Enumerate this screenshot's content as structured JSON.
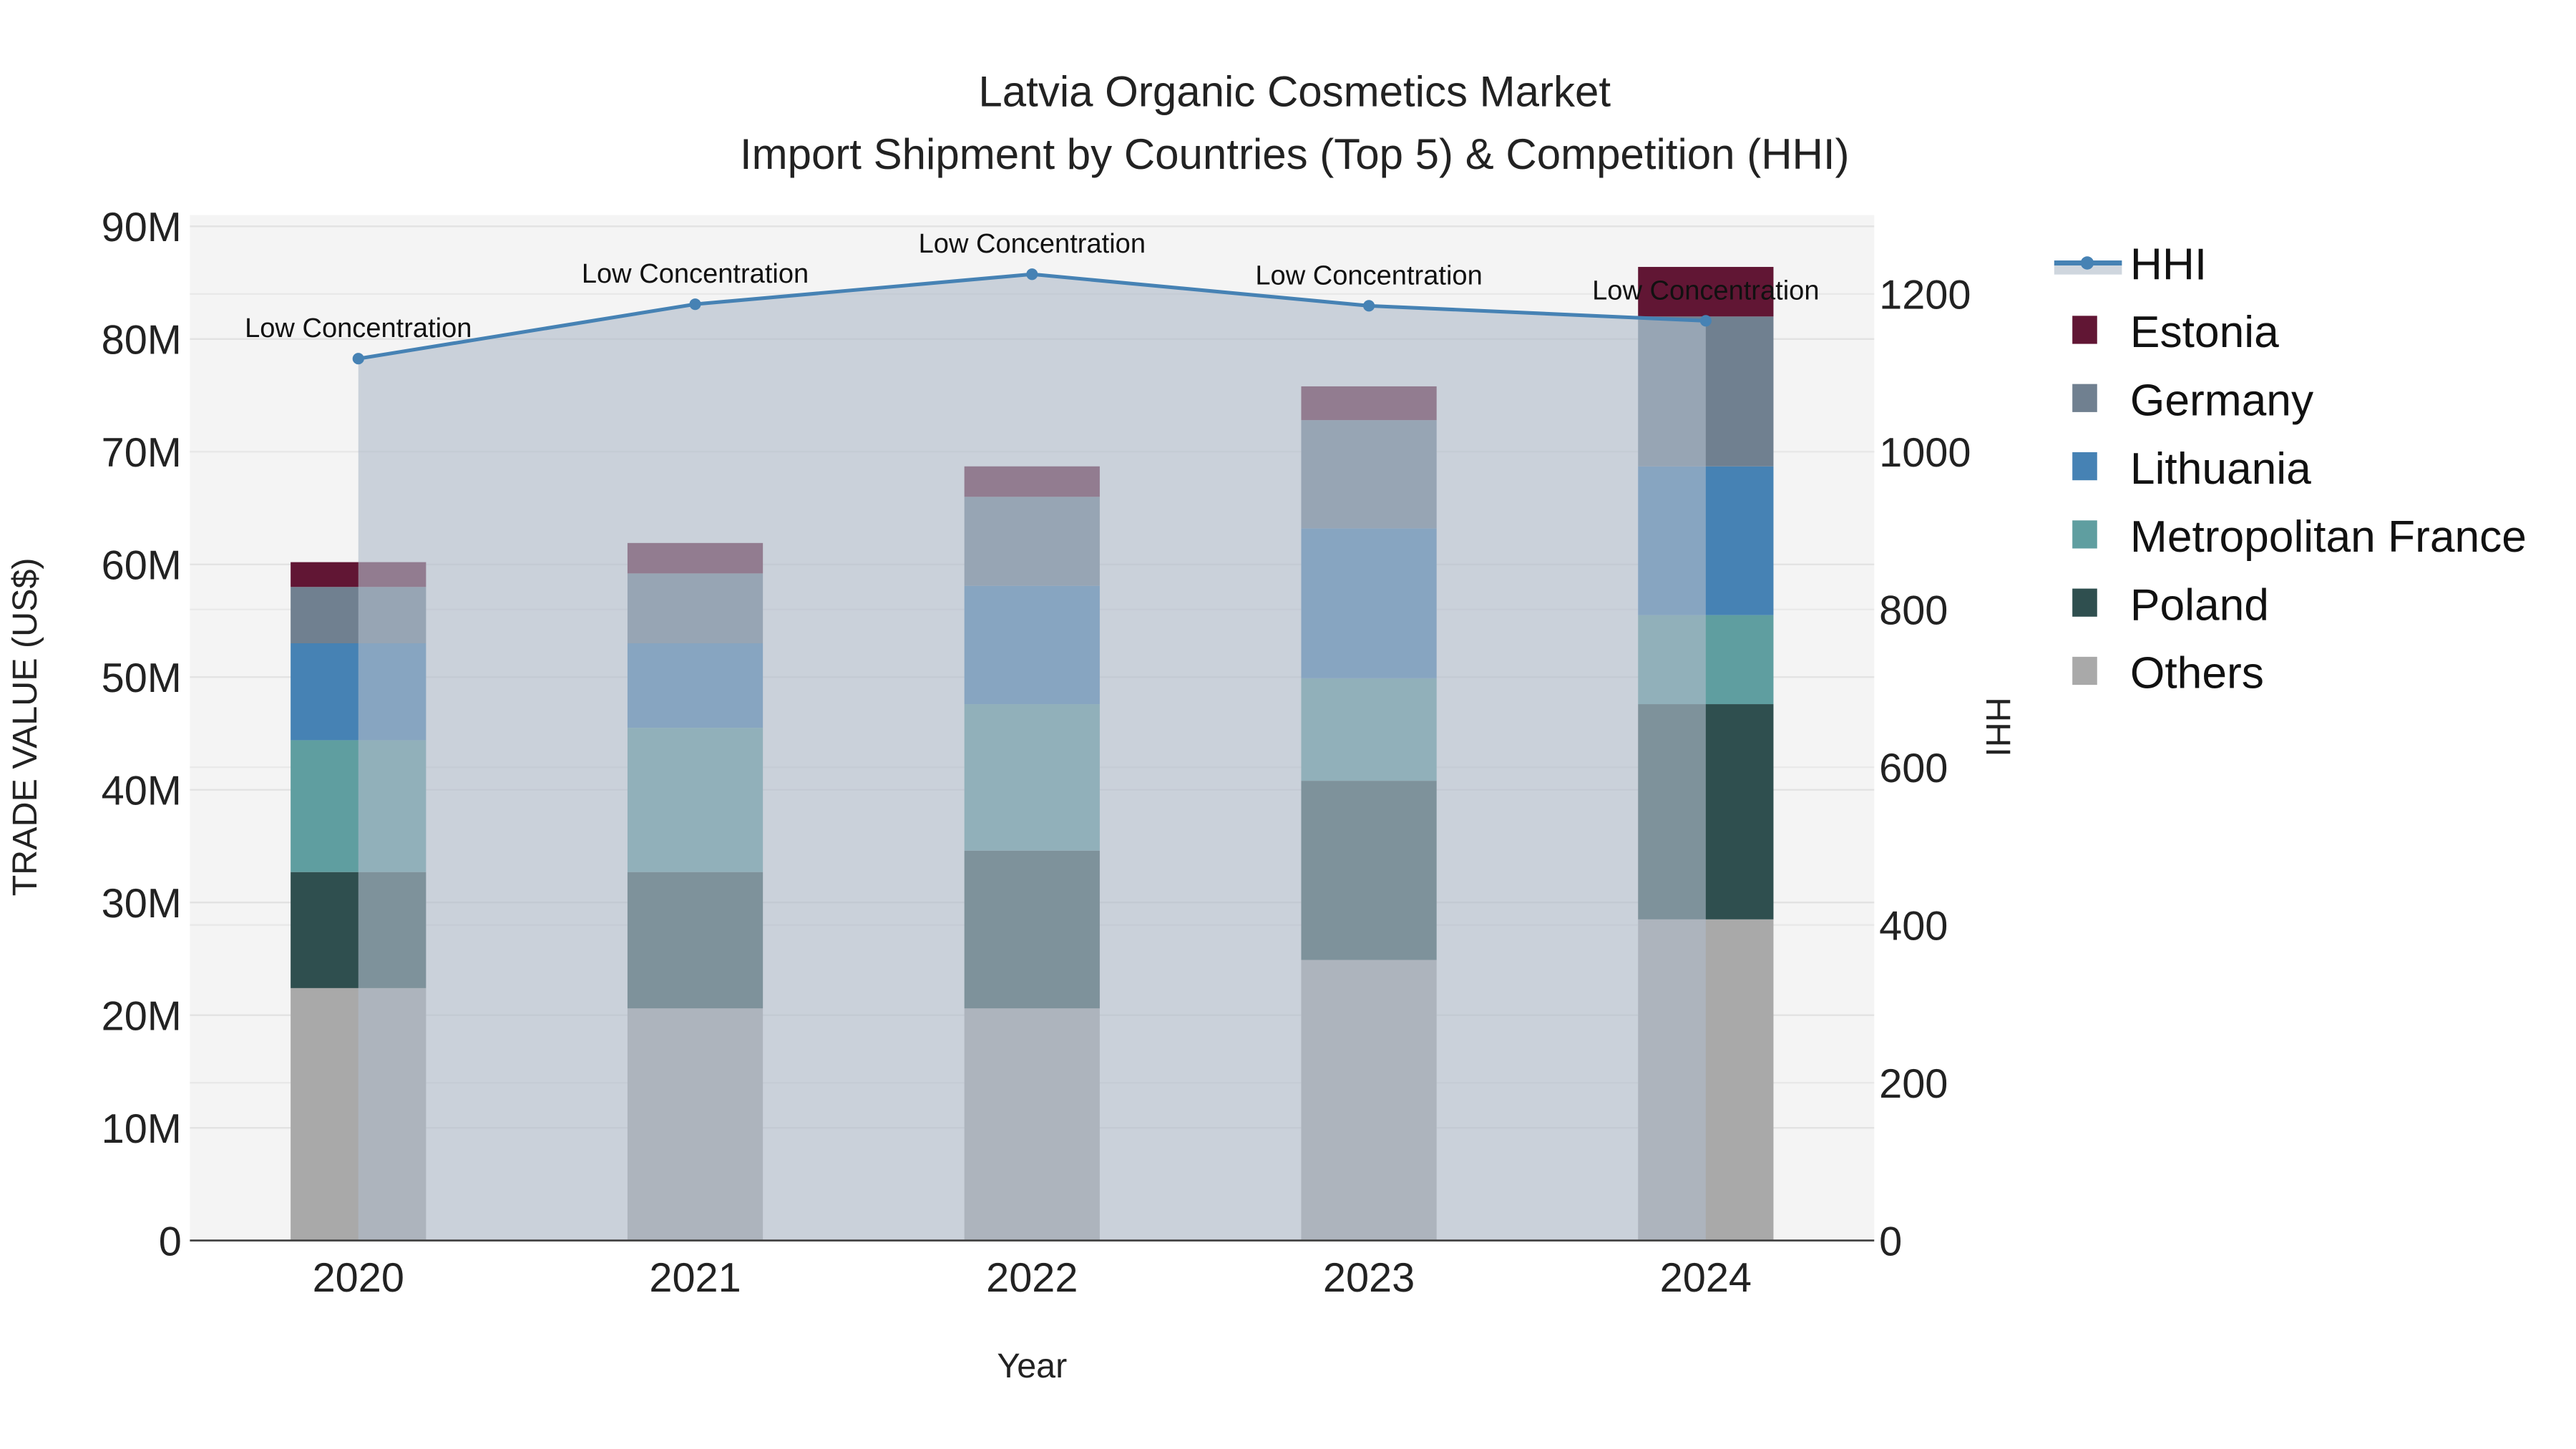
{
  "chart_data": {
    "type": "bar",
    "stacked": true,
    "title": "Latvia Organic Cosmetics Market",
    "subtitle": "Import Shipment by Countries (Top 5) & Competition (HHI)",
    "xlabel": "Year",
    "ylabel": "TRADE VALUE (US$)",
    "y2label": "HHI",
    "categories": [
      "2020",
      "2021",
      "2022",
      "2023",
      "2024"
    ],
    "ylim": [
      0,
      91000000
    ],
    "y2lim": [
      0,
      1300
    ],
    "yticks": [
      {
        "v": 0,
        "label": "0"
      },
      {
        "v": 10000000,
        "label": "10M"
      },
      {
        "v": 20000000,
        "label": "20M"
      },
      {
        "v": 30000000,
        "label": "30M"
      },
      {
        "v": 40000000,
        "label": "40M"
      },
      {
        "v": 50000000,
        "label": "50M"
      },
      {
        "v": 60000000,
        "label": "60M"
      },
      {
        "v": 70000000,
        "label": "70M"
      },
      {
        "v": 80000000,
        "label": "80M"
      },
      {
        "v": 90000000,
        "label": "90M"
      }
    ],
    "y2ticks": [
      {
        "v": 0,
        "label": "0"
      },
      {
        "v": 200,
        "label": "200"
      },
      {
        "v": 400,
        "label": "400"
      },
      {
        "v": 600,
        "label": "600"
      },
      {
        "v": 800,
        "label": "800"
      },
      {
        "v": 1000,
        "label": "1000"
      },
      {
        "v": 1200,
        "label": "1200"
      }
    ],
    "series": [
      {
        "name": "Others",
        "color": "#a9a9a9",
        "values": [
          22400000,
          20600000,
          20600000,
          24900000,
          28500000
        ]
      },
      {
        "name": "Poland",
        "color": "#2f4f4f",
        "values": [
          10300000,
          12100000,
          14000000,
          15900000,
          19100000
        ]
      },
      {
        "name": "Metropolitan France",
        "color": "#5f9ea0",
        "values": [
          11700000,
          12800000,
          13000000,
          9100000,
          7900000
        ]
      },
      {
        "name": "Lithuania",
        "color": "#4682b4",
        "values": [
          8600000,
          7500000,
          10500000,
          13300000,
          13200000
        ]
      },
      {
        "name": "Germany",
        "color": "#708090",
        "values": [
          5000000,
          6200000,
          7900000,
          9600000,
          13300000
        ]
      },
      {
        "name": "Estonia",
        "color": "#611634",
        "values": [
          2200000,
          2700000,
          2700000,
          3000000,
          4400000
        ]
      }
    ],
    "hhi": {
      "name": "HHI",
      "color": "#4682b4",
      "values": [
        1118,
        1187,
        1225,
        1185,
        1166
      ],
      "labels": [
        "Low Concentration",
        "Low Concentration",
        "Low Concentration",
        "Low Concentration",
        "Low Concentration"
      ]
    },
    "legend": {
      "placement": "right",
      "order": [
        "HHI",
        "Estonia",
        "Germany",
        "Lithuania",
        "Metropolitan France",
        "Poland",
        "Others"
      ]
    }
  }
}
